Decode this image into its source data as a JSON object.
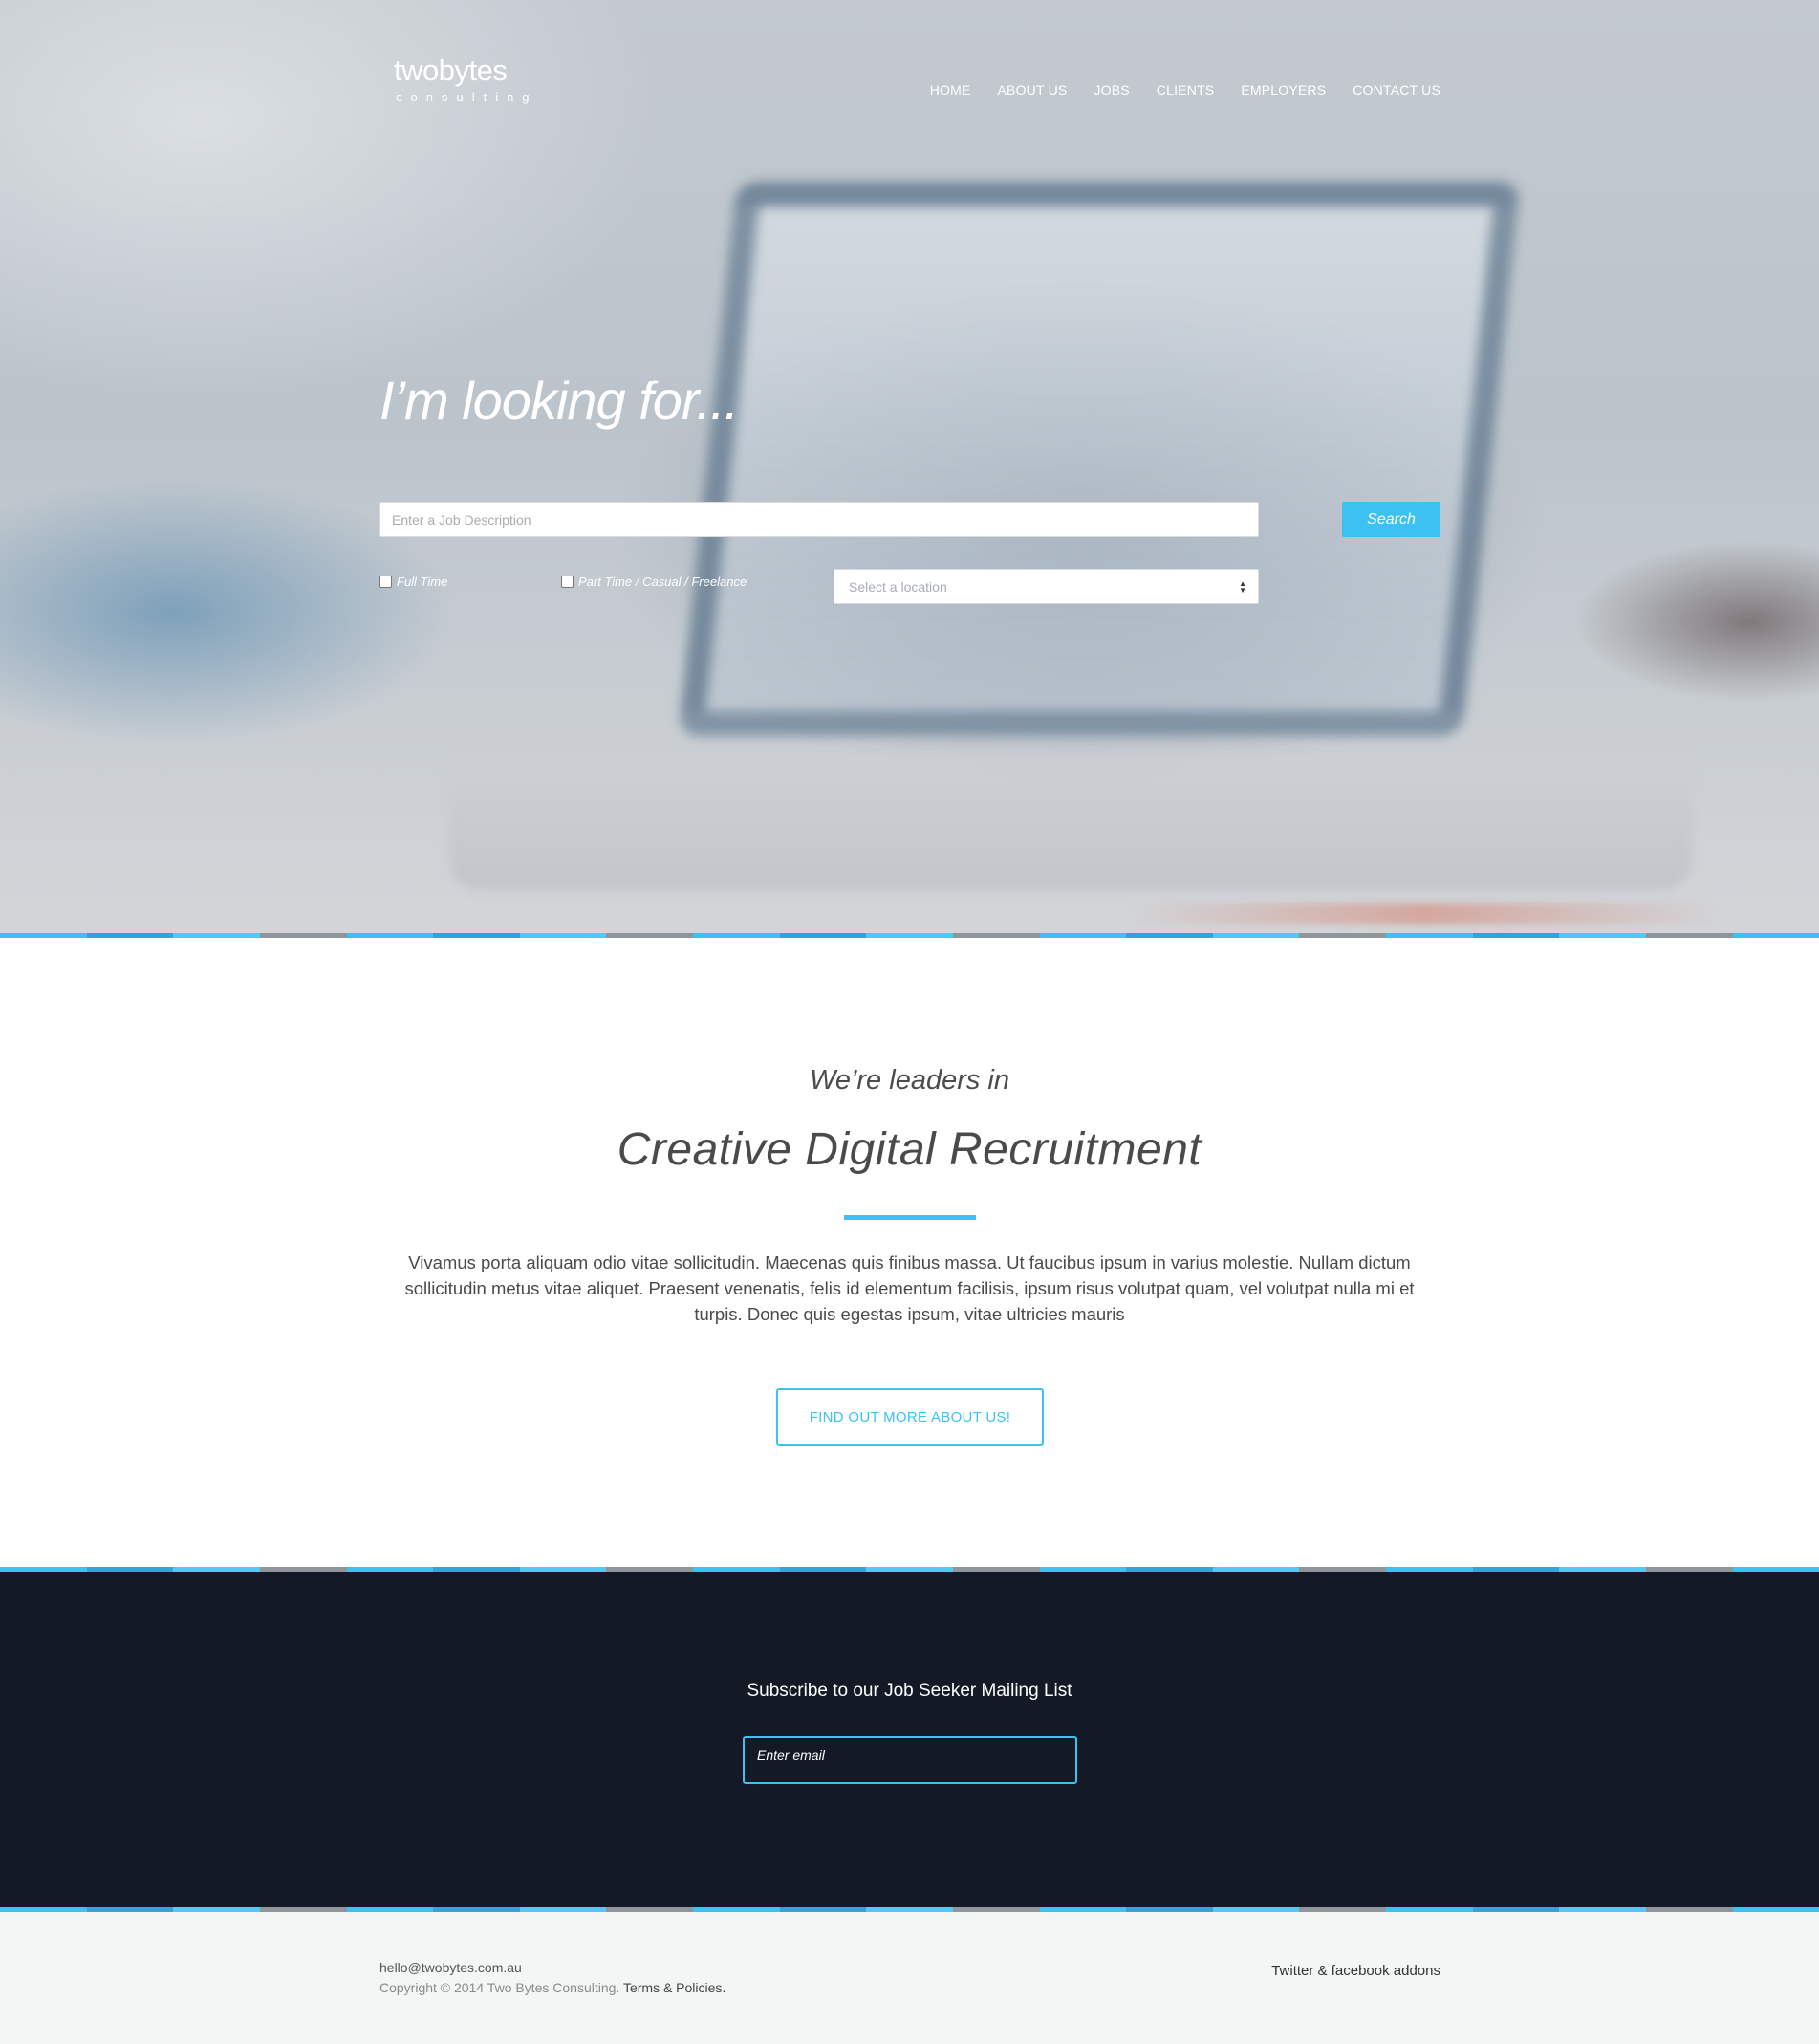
{
  "brand": {
    "name": "twobytes",
    "tagline": "consulting"
  },
  "nav": {
    "items": [
      "HOME",
      "ABOUT US",
      "JOBS",
      "CLIENTS",
      "EMPLOYERS",
      "CONTACT US"
    ]
  },
  "hero": {
    "title": "I’m looking for...",
    "job_placeholder": "Enter a Job Description",
    "search_label": "Search",
    "checkbox_full_time": "Full Time",
    "checkbox_part_time": "Part Time / Casual / Freelance",
    "location_placeholder": "Select a location"
  },
  "about": {
    "kicker": "We’re leaders in",
    "title": "Creative Digital Recruitment",
    "text": "Vivamus porta aliquam odio vitae sollicitudin. Maecenas quis finibus massa. Ut faucibus ipsum in varius molestie. Nullam dictum sollicitudin metus vitae aliquet. Praesent venenatis, felis id elementum facilisis, ipsum risus volutpat quam, vel volutpat nulla mi et turpis. Donec quis egestas ipsum, vitae ultricies mauris",
    "button_label": "FIND OUT MORE ABOUT US!"
  },
  "subscribe": {
    "title": "Subscribe to our Job Seeker Mailing List",
    "email_placeholder": "Enter email"
  },
  "footer": {
    "email": "hello@twobytes.com.au",
    "copyright": "Copyright © 2014 Two Bytes Consulting.",
    "terms_label": "Terms & Policies.",
    "social": "Twitter & facebook addons"
  },
  "colors": {
    "accent": "#3cc1f3",
    "dark": "#131a25",
    "footer_bg": "#f4f5f5",
    "stripe": [
      "#3cc1f3",
      "#2ea6dc",
      "#4fcaf5",
      "#8f959a"
    ]
  }
}
